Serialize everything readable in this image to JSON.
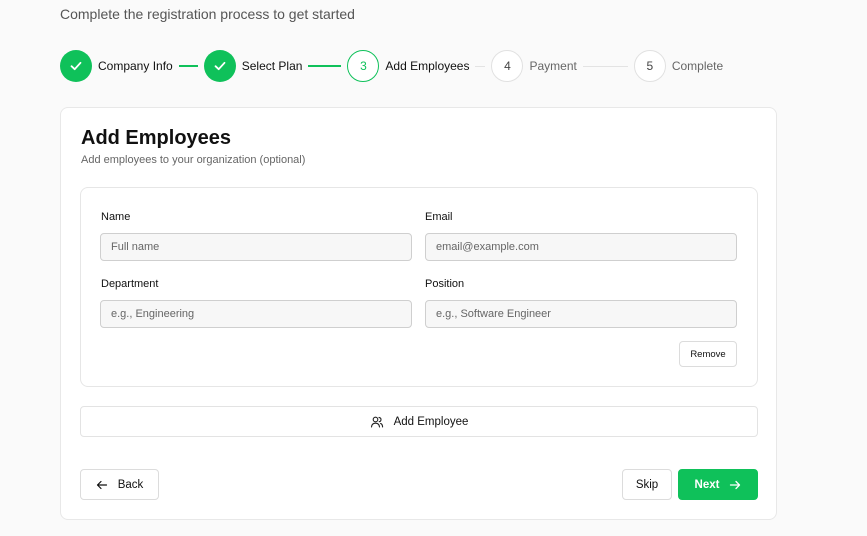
{
  "header": {
    "subtitle": "Complete the registration process to get started"
  },
  "stepper": {
    "steps": [
      {
        "number": "1",
        "label": "Company Info",
        "status": "done"
      },
      {
        "number": "2",
        "label": "Select Plan",
        "status": "done"
      },
      {
        "number": "3",
        "label": "Add Employees",
        "status": "current"
      },
      {
        "number": "4",
        "label": "Payment",
        "status": "todo"
      },
      {
        "number": "5",
        "label": "Complete",
        "status": "todo"
      }
    ]
  },
  "card": {
    "title": "Add Employees",
    "description": "Add employees to your organization (optional)"
  },
  "employee_form": {
    "name_label": "Name",
    "name_placeholder": "Full name",
    "email_label": "Email",
    "email_placeholder": "email@example.com",
    "department_label": "Department",
    "department_placeholder": "e.g., Engineering",
    "position_label": "Position",
    "position_placeholder": "e.g., Software Engineer",
    "remove_label": "Remove"
  },
  "actions": {
    "add_employee_label": "Add Employee",
    "back_label": "Back",
    "skip_label": "Skip",
    "next_label": "Next"
  },
  "colors": {
    "accent": "#0fc15a",
    "border": "#e6e6e6"
  }
}
